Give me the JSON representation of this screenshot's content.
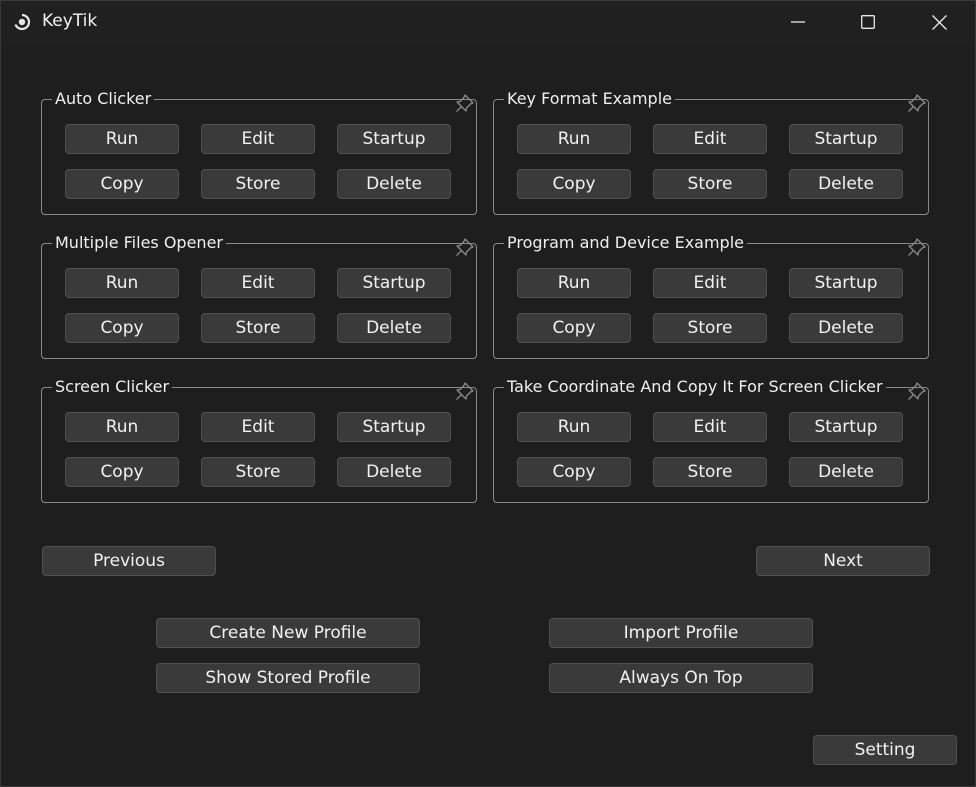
{
  "window": {
    "title": "KeyTik",
    "app_icon": "circle-spinner-icon",
    "controls": [
      {
        "name": "minimize-button",
        "icon": "minimize-icon"
      },
      {
        "name": "maximize-button",
        "icon": "maximize-icon"
      },
      {
        "name": "close-button",
        "icon": "close-icon"
      }
    ]
  },
  "profiles": [
    {
      "title": "Auto Clicker"
    },
    {
      "title": "Key Format Example"
    },
    {
      "title": "Multiple Files Opener"
    },
    {
      "title": "Program and Device Example"
    },
    {
      "title": "Screen Clicker"
    },
    {
      "title": "Take Coordinate And Copy It For Screen Clicker"
    }
  ],
  "profile_buttons": {
    "run": "Run",
    "edit": "Edit",
    "startup": "Startup",
    "copy": "Copy",
    "store": "Store",
    "delete": "Delete"
  },
  "profile_pin_icon": "pin-icon",
  "pagination": {
    "previous": "Previous",
    "next": "Next"
  },
  "actions": {
    "create_new_profile": "Create New Profile",
    "import_profile": "Import Profile",
    "show_stored_profile": "Show Stored Profile",
    "always_on_top": "Always On Top"
  },
  "setting": "Setting",
  "colors": {
    "background": "#1e1e1e",
    "titlebar": "#202020",
    "button": "#3a3a3a",
    "button_border": "#505050",
    "group_border": "#8a8a8a",
    "text": "#f2f2f2"
  }
}
